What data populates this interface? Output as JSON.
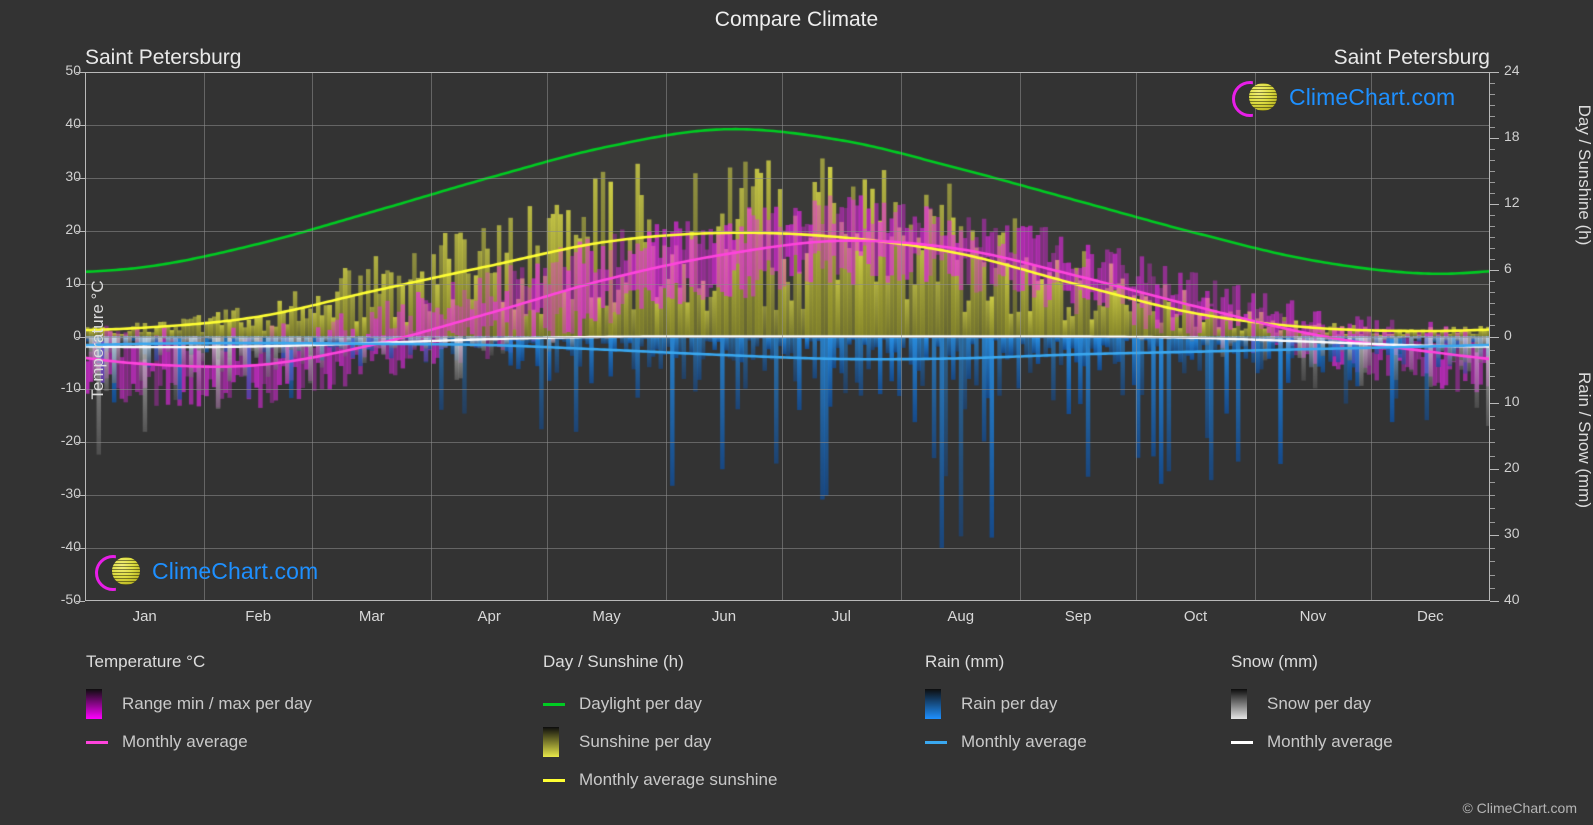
{
  "header": {
    "title": "Compare Climate",
    "city_left": "Saint Petersburg",
    "city_right": "Saint Petersburg"
  },
  "axes": {
    "left_label": "Temperature °C",
    "right_label_top": "Day / Sunshine (h)",
    "right_label_bottom": "Rain / Snow (mm)",
    "temp_ticks": [
      "50",
      "40",
      "30",
      "20",
      "10",
      "0",
      "-10",
      "-20",
      "-30",
      "-40",
      "-50"
    ],
    "day_ticks": [
      "24",
      "18",
      "12",
      "6",
      "0"
    ],
    "rain_ticks": [
      "0",
      "10",
      "20",
      "30",
      "40"
    ],
    "months": [
      "Jan",
      "Feb",
      "Mar",
      "Apr",
      "May",
      "Jun",
      "Jul",
      "Aug",
      "Sep",
      "Oct",
      "Nov",
      "Dec"
    ]
  },
  "legend": {
    "temperature": {
      "heading": "Temperature °C",
      "items": [
        {
          "label": "Range min / max per day",
          "swatch": "gradient-box",
          "color": "#ff00ff"
        },
        {
          "label": "Monthly average",
          "swatch": "line",
          "color": "#ff44dd"
        }
      ]
    },
    "day_sunshine": {
      "heading": "Day / Sunshine (h)",
      "items": [
        {
          "label": "Daylight per day",
          "swatch": "line",
          "color": "#00cc22"
        },
        {
          "label": "Sunshine per day",
          "swatch": "gradient-box",
          "color": "#e8e84a"
        },
        {
          "label": "Monthly average sunshine",
          "swatch": "line",
          "color": "#ffff33"
        }
      ]
    },
    "rain": {
      "heading": "Rain (mm)",
      "items": [
        {
          "label": "Rain per day",
          "swatch": "gradient-box",
          "color": "#1e90ff"
        },
        {
          "label": "Monthly average",
          "swatch": "line",
          "color": "#3aa8f0"
        }
      ]
    },
    "snow": {
      "heading": "Snow (mm)",
      "items": [
        {
          "label": "Snow per day",
          "swatch": "gradient-box",
          "color": "#e6e6e6"
        },
        {
          "label": "Monthly average",
          "swatch": "line",
          "color": "#ffffff"
        }
      ]
    }
  },
  "logo": {
    "text": "ClimeChart.com"
  },
  "copyright": "© ClimeChart.com",
  "chart_data": {
    "type": "line",
    "title": "Compare Climate",
    "subtitle": "Saint Petersburg",
    "xlabel": "",
    "ylabel": "Temperature °C",
    "ylim": [
      -50,
      50
    ],
    "y2lim_day": [
      0,
      24
    ],
    "y2lim_rain": [
      0,
      40
    ],
    "grid": true,
    "legend_position": "bottom",
    "categories": [
      "Jan",
      "Feb",
      "Mar",
      "Apr",
      "May",
      "Jun",
      "Jul",
      "Aug",
      "Sep",
      "Oct",
      "Nov",
      "Dec"
    ],
    "series": [
      {
        "name": "Daylight per day",
        "units": "h",
        "axis": "day",
        "color": "#00cc22",
        "values": [
          6.3,
          8.4,
          11.3,
          14.4,
          17.2,
          18.8,
          17.8,
          15.2,
          12.3,
          9.4,
          6.9,
          5.7
        ]
      },
      {
        "name": "Monthly average sunshine",
        "units": "h",
        "axis": "day",
        "color": "#ffff33",
        "values": [
          0.8,
          1.8,
          4.1,
          6.4,
          8.6,
          9.4,
          9.0,
          7.5,
          4.7,
          2.1,
          0.8,
          0.5
        ]
      },
      {
        "name": "Monthly average temperature",
        "units": "°C",
        "axis": "temp",
        "color": "#ff44dd",
        "values": [
          -5.2,
          -5.4,
          -1.6,
          4.4,
          10.8,
          15.5,
          18.1,
          16.5,
          11.4,
          5.7,
          0.4,
          -2.9
        ]
      },
      {
        "name": "Monthly average rain",
        "units": "mm",
        "axis": "rain",
        "color": "#3aa8f0",
        "values": [
          1.1,
          1.0,
          1.1,
          1.3,
          2.0,
          2.8,
          3.4,
          3.3,
          2.7,
          2.3,
          1.9,
          1.5
        ]
      },
      {
        "name": "Monthly average snow",
        "units": "mm",
        "axis": "rain",
        "color": "#ffffff",
        "values": [
          1.6,
          1.5,
          1.0,
          0.4,
          0.05,
          0.0,
          0.0,
          0.0,
          0.0,
          0.2,
          0.8,
          1.4
        ]
      },
      {
        "name": "Temperature range min per day",
        "units": "°C",
        "axis": "temp",
        "color": "#ff00ff",
        "values": [
          -9.5,
          -9.8,
          -5.8,
          -0.4,
          5.0,
          10.2,
          13.4,
          12.1,
          7.6,
          2.6,
          -2.2,
          -6.6
        ]
      },
      {
        "name": "Temperature range max per day",
        "units": "°C",
        "axis": "temp",
        "color": "#ff00ff",
        "values": [
          -1.8,
          -1.6,
          2.4,
          9.1,
          16.3,
          20.6,
          23.0,
          21.0,
          15.4,
          8.6,
          2.4,
          -0.6
        ]
      }
    ]
  }
}
